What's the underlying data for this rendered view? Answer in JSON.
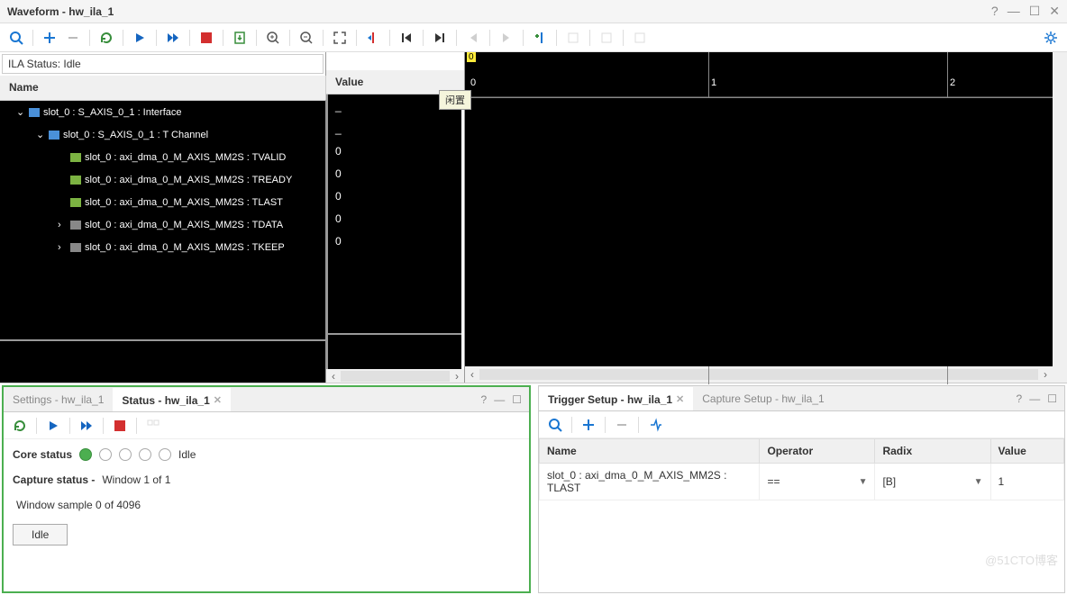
{
  "title": "Waveform - hw_ila_1",
  "ila_status": "ILA Status: Idle",
  "tooltip": "闲置",
  "headers": {
    "name": "Name",
    "value": "Value"
  },
  "ruler": {
    "marker": "0",
    "ticks": [
      "0",
      "1",
      "2"
    ]
  },
  "signals": [
    {
      "name": "slot_0 : S_AXIS_0_1 : Interface",
      "value": "_",
      "level": 1,
      "exp": "v",
      "icon": "bus"
    },
    {
      "name": "slot_0 : S_AXIS_0_1 : T Channel",
      "value": "_",
      "level": 2,
      "exp": "v",
      "icon": "bus"
    },
    {
      "name": "slot_0 : axi_dma_0_M_AXIS_MM2S : TVALID",
      "value": "0",
      "level": 3,
      "exp": "",
      "icon": "sig"
    },
    {
      "name": "slot_0 : axi_dma_0_M_AXIS_MM2S : TREADY",
      "value": "0",
      "level": 3,
      "exp": "",
      "icon": "sig"
    },
    {
      "name": "slot_0 : axi_dma_0_M_AXIS_MM2S : TLAST",
      "value": "0",
      "level": 3,
      "exp": "",
      "icon": "sig"
    },
    {
      "name": "slot_0 : axi_dma_0_M_AXIS_MM2S : TDATA",
      "value": "0",
      "level": 3,
      "exp": ">",
      "icon": "grp"
    },
    {
      "name": "slot_0 : axi_dma_0_M_AXIS_MM2S : TKEEP",
      "value": "0",
      "level": 3,
      "exp": ">",
      "icon": "grp"
    }
  ],
  "status_panel": {
    "tab_settings": "Settings - hw_ila_1",
    "tab_status": "Status - hw_ila_1",
    "core_status_label": "Core status",
    "core_status_value": "Idle",
    "capture_status_label": "Capture status -",
    "capture_window": "Window 1 of 1",
    "window_sample": "Window sample 0 of 4096",
    "idle_button": "Idle"
  },
  "trigger_panel": {
    "tab_trigger": "Trigger Setup - hw_ila_1",
    "tab_capture": "Capture Setup - hw_ila_1",
    "headers": {
      "name": "Name",
      "operator": "Operator",
      "radix": "Radix",
      "value": "Value"
    },
    "row": {
      "name": "slot_0 : axi_dma_0_M_AXIS_MM2S : TLAST",
      "operator": "==",
      "radix": "[B]",
      "value": "1"
    }
  },
  "watermark": "@51CTO博客"
}
